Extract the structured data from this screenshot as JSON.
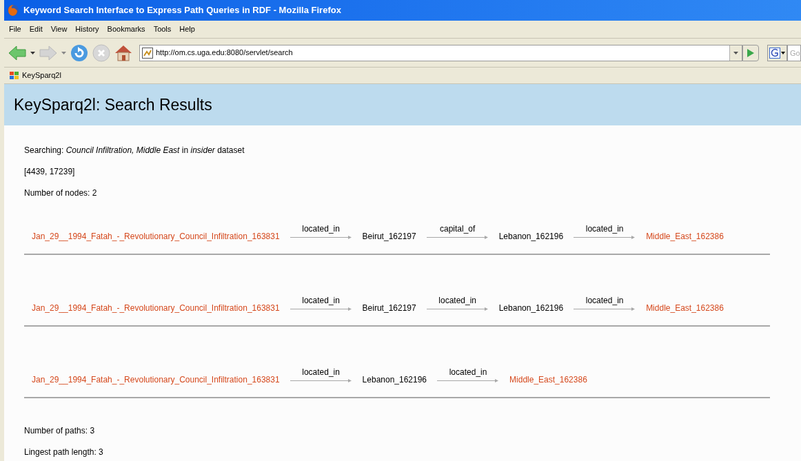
{
  "window": {
    "title": "Keyword Search Interface to Express Path Queries in RDF - Mozilla Firefox"
  },
  "menu": [
    "File",
    "Edit",
    "View",
    "History",
    "Bookmarks",
    "Tools",
    "Help"
  ],
  "address": {
    "value": "http://om.cs.uga.edu:8080/servlet/search"
  },
  "search": {
    "placeholder": "Go"
  },
  "bookmarks": [
    "KeySparq2l"
  ],
  "page": {
    "heading": "KeySparq2l: Search Results",
    "info": [
      "Searching: *Council Infiltration, Middle East* in *insider* dataset",
      "[4439, 17239]",
      "Number of nodes: 2"
    ],
    "paths": [
      {
        "steps": [
          {
            "kind": "node",
            "label": "Jan_29__1994_Fatah_-_Revolutionary_Council_Infiltration_163831",
            "matched": true
          },
          {
            "kind": "edge",
            "label": "located_in"
          },
          {
            "kind": "node",
            "label": "Beirut_162197",
            "matched": false
          },
          {
            "kind": "edge",
            "label": "capital_of"
          },
          {
            "kind": "node",
            "label": "Lebanon_162196",
            "matched": false
          },
          {
            "kind": "edge",
            "label": "located_in"
          },
          {
            "kind": "node",
            "label": "Middle_East_162386",
            "matched": true
          }
        ]
      },
      {
        "steps": [
          {
            "kind": "node",
            "label": "Jan_29__1994_Fatah_-_Revolutionary_Council_Infiltration_163831",
            "matched": true
          },
          {
            "kind": "edge",
            "label": "located_in"
          },
          {
            "kind": "node",
            "label": "Beirut_162197",
            "matched": false
          },
          {
            "kind": "edge",
            "label": "located_in"
          },
          {
            "kind": "node",
            "label": "Lebanon_162196",
            "matched": false
          },
          {
            "kind": "edge",
            "label": "located_in"
          },
          {
            "kind": "node",
            "label": "Middle_East_162386",
            "matched": true
          }
        ]
      },
      {
        "steps": [
          {
            "kind": "node",
            "label": "Jan_29__1994_Fatah_-_Revolutionary_Council_Infiltration_163831",
            "matched": true
          },
          {
            "kind": "edge",
            "label": "located_in"
          },
          {
            "kind": "node",
            "label": "Lebanon_162196",
            "matched": false
          },
          {
            "kind": "edge",
            "label": "located_in"
          },
          {
            "kind": "node",
            "label": "Middle_East_162386",
            "matched": true
          }
        ]
      }
    ],
    "summary": [
      "Number of paths: 3",
      "Lingest path length: 3"
    ]
  }
}
